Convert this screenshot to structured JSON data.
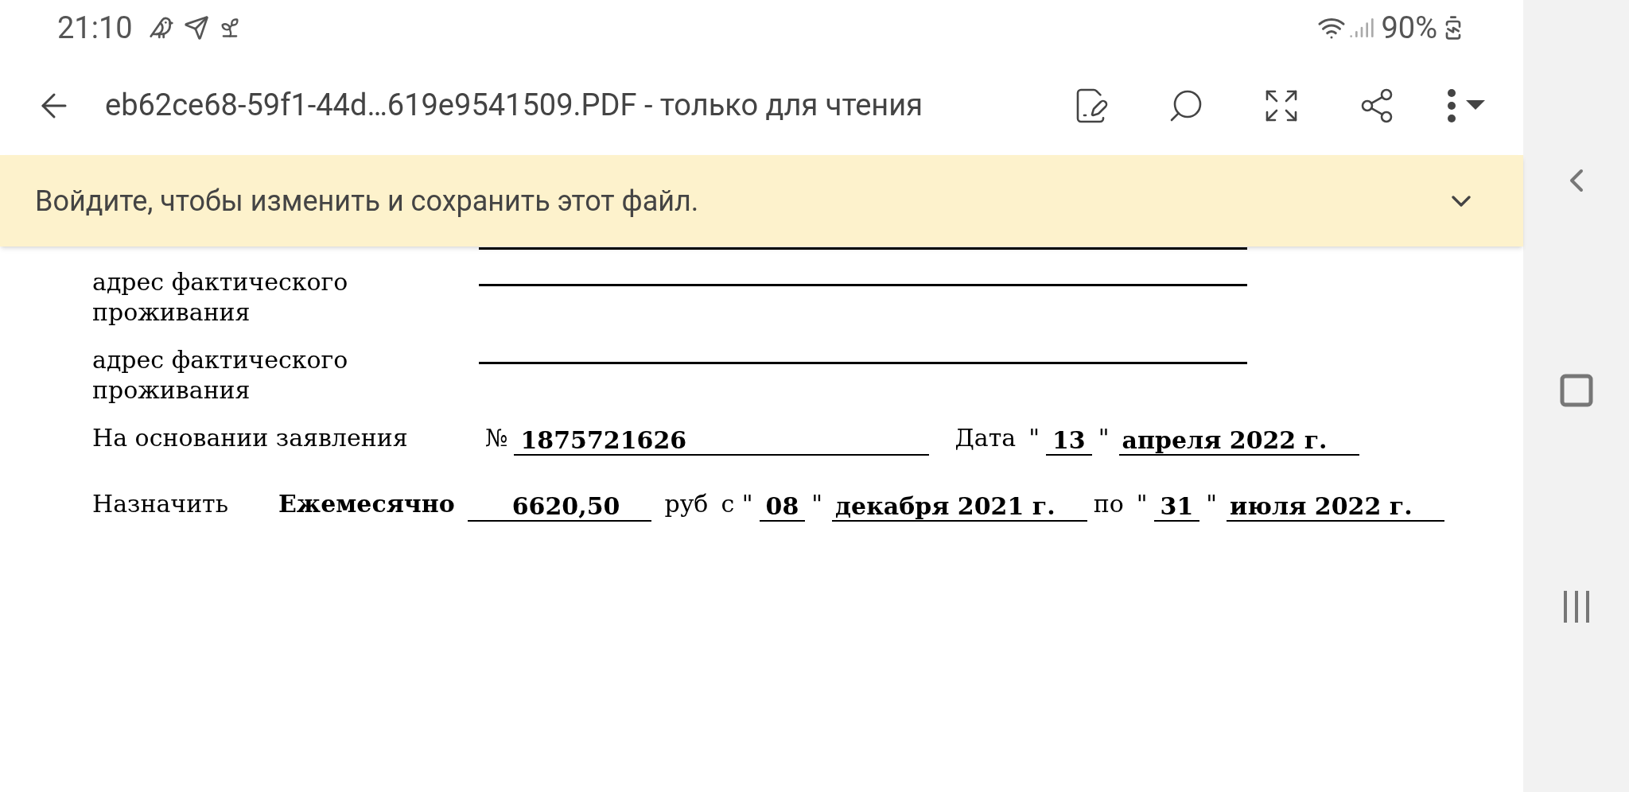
{
  "status_bar": {
    "time": "21:10",
    "battery": "90%"
  },
  "toolbar": {
    "title": "eb62ce68-59f1-44d…619e9541509.PDF - только для чтения"
  },
  "banner": {
    "text": "Войдите, чтобы изменить и сохранить этот файл."
  },
  "document": {
    "address_rows": [
      {
        "label": "адрес фактического проживания"
      },
      {
        "label": "адрес фактического проживания"
      }
    ],
    "lines": [
      {
        "items": [
          {
            "kind": "label",
            "text": "На основании заявления"
          },
          {
            "kind": "text",
            "text": "№"
          },
          {
            "kind": "field_long",
            "text": "1875721626"
          },
          {
            "kind": "text",
            "text": "Дата"
          },
          {
            "kind": "text",
            "text": "\""
          },
          {
            "kind": "field",
            "text": "13"
          },
          {
            "kind": "text",
            "text": "\""
          },
          {
            "kind": "field_mid",
            "text": "апреля 2022 г."
          }
        ]
      },
      {
        "items": [
          {
            "kind": "label_short",
            "text": "Назначить"
          },
          {
            "kind": "bold",
            "text": "Ежемесячно"
          },
          {
            "kind": "field_amount",
            "text": "6620,50"
          },
          {
            "kind": "text",
            "text": "руб"
          },
          {
            "kind": "text",
            "text": "с \""
          },
          {
            "kind": "field",
            "text": "08"
          },
          {
            "kind": "text",
            "text": "\""
          },
          {
            "kind": "field_mid",
            "text": "декабря 2021 г."
          },
          {
            "kind": "text",
            "text": "по"
          },
          {
            "kind": "text",
            "text": "\""
          },
          {
            "kind": "field",
            "text": "31"
          },
          {
            "kind": "text",
            "text": "\""
          },
          {
            "kind": "field_mid",
            "text": "июля 2022 г."
          }
        ]
      }
    ]
  }
}
